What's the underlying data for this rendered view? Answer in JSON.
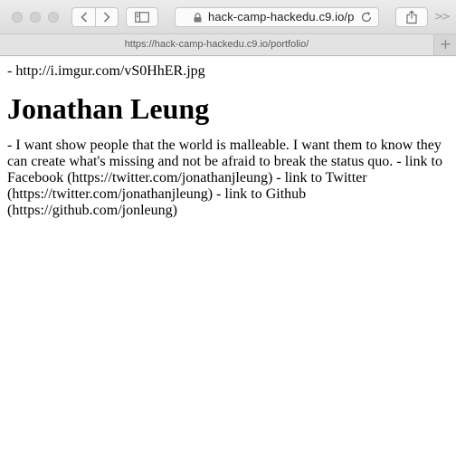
{
  "browser": {
    "address_url": "hack-camp-hackedu.c9.io/p",
    "tab_title": "https://hack-camp-hackedu.c9.io/portfolio/"
  },
  "icons": {
    "back": "chevron-left-icon",
    "forward": "chevron-right-icon",
    "sidebar": "sidebar-icon",
    "lock": "lock-icon",
    "reload": "reload-icon",
    "share": "share-icon",
    "overflow": "overflow-icon",
    "new_tab": "plus-icon"
  },
  "page": {
    "image_line": "- http://i.imgur.com/vS0HhER.jpg",
    "heading": "Jonathan Leung",
    "bio": "- I want show people that the world is malleable. I want them to know they can create what's missing and not be afraid to break the status quo. - link to Facebook (https://twitter.com/jonathanjleung) - link to Twitter (https://twitter.com/jonathanjleung) - link to Github (https://github.com/jonleung)"
  }
}
